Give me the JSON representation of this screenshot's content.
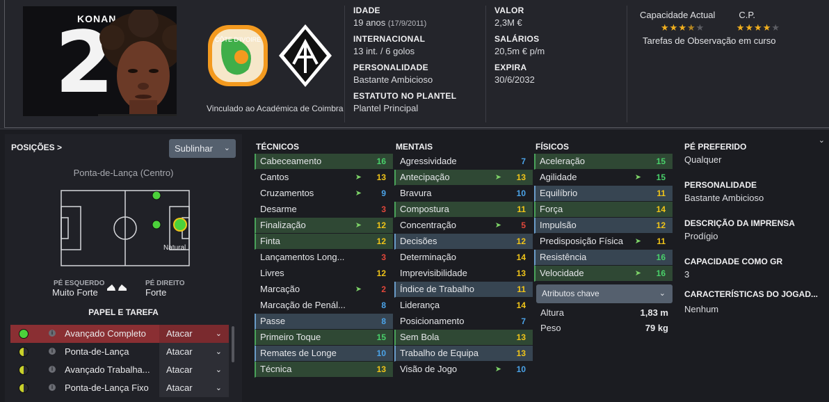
{
  "header": {
    "portrait_name": "KONAN",
    "portrait_number": "2",
    "crest_caption": "Vinculado ao Académica de Coimbra",
    "nation_crest_text": "CÔTE D'IVOIRE",
    "info_col1": [
      {
        "label": "IDADE",
        "value": "19 anos",
        "sub": "(17/9/2011)"
      },
      {
        "label": "INTERNACIONAL",
        "value": "13 int. / 6 golos"
      },
      {
        "label": "PERSONALIDADE",
        "value": "Bastante Ambicioso"
      },
      {
        "label": "ESTATUTO NO PLANTEL",
        "value": "Plantel Principal"
      }
    ],
    "info_col2": [
      {
        "label": "VALOR",
        "value": "2,3M €"
      },
      {
        "label": "SALÁRIOS",
        "value": "20,5m € p/m"
      },
      {
        "label": "EXPIRA",
        "value": "30/6/2032"
      }
    ],
    "ability": {
      "current_label": "Capacidade Actual",
      "potential_label": "C.P.",
      "current_stars": 3.5,
      "potential_stars": 4,
      "max_stars": 5,
      "scouting": "Tarefas de Observação em curso"
    }
  },
  "left": {
    "positions_title": "POSIÇÕES >",
    "highlight_button": "Sublinhar",
    "position_name": "Ponta-de-Lança (Centro)",
    "natural_label": "Natural",
    "left_foot_label": "PÉ ESQUERDO",
    "left_foot_value": "Muito Forte",
    "right_foot_label": "PÉ DIREITO",
    "right_foot_value": "Forte",
    "role_title": "PAPEL E TAREFA",
    "roles": [
      {
        "name": "Avançado Completo",
        "duty": "Atacar",
        "selected": true,
        "dot": "full"
      },
      {
        "name": "Ponta-de-Lança",
        "duty": "Atacar",
        "selected": false,
        "dot": "half"
      },
      {
        "name": "Avançado Trabalha...",
        "duty": "Atacar",
        "selected": false,
        "dot": "half"
      },
      {
        "name": "Ponta-de-Lança Fixo",
        "duty": "Atacar",
        "selected": false,
        "dot": "half"
      }
    ],
    "colors": {
      "role_selected": "#8a2f33",
      "dot_green": "#4cd13b",
      "dot_yellow": "#c9d12b"
    }
  },
  "attributes": {
    "technical": {
      "title": "TÉCNICOS",
      "items": [
        {
          "name": "Cabeceamento",
          "value": "16",
          "hl": "green",
          "arrow": false
        },
        {
          "name": "Cantos",
          "value": "13",
          "hl": "",
          "arrow": true
        },
        {
          "name": "Cruzamentos",
          "value": "9",
          "hl": "",
          "arrow": true
        },
        {
          "name": "Desarme",
          "value": "3",
          "hl": "",
          "arrow": false
        },
        {
          "name": "Finalização",
          "value": "12",
          "hl": "green",
          "arrow": true
        },
        {
          "name": "Finta",
          "value": "12",
          "hl": "green",
          "arrow": false
        },
        {
          "name": "Lançamentos Long...",
          "value": "3",
          "hl": "",
          "arrow": false
        },
        {
          "name": "Livres",
          "value": "12",
          "hl": "",
          "arrow": false
        },
        {
          "name": "Marcação",
          "value": "2",
          "hl": "",
          "arrow": true
        },
        {
          "name": "Marcação de Penál...",
          "value": "8",
          "hl": "",
          "arrow": false
        },
        {
          "name": "Passe",
          "value": "8",
          "hl": "blue",
          "arrow": false
        },
        {
          "name": "Primeiro Toque",
          "value": "15",
          "hl": "green",
          "arrow": false
        },
        {
          "name": "Remates de Longe",
          "value": "10",
          "hl": "blue",
          "arrow": false
        },
        {
          "name": "Técnica",
          "value": "13",
          "hl": "green",
          "arrow": false
        }
      ]
    },
    "mental": {
      "title": "MENTAIS",
      "items": [
        {
          "name": "Agressividade",
          "value": "7",
          "hl": "",
          "arrow": false
        },
        {
          "name": "Antecipação",
          "value": "13",
          "hl": "green",
          "arrow": true
        },
        {
          "name": "Bravura",
          "value": "10",
          "hl": "",
          "arrow": false
        },
        {
          "name": "Compostura",
          "value": "11",
          "hl": "green",
          "arrow": false
        },
        {
          "name": "Concentração",
          "value": "5",
          "hl": "",
          "arrow": true
        },
        {
          "name": "Decisões",
          "value": "12",
          "hl": "blue",
          "arrow": false
        },
        {
          "name": "Determinação",
          "value": "14",
          "hl": "",
          "arrow": false
        },
        {
          "name": "Imprevisibilidade",
          "value": "13",
          "hl": "",
          "arrow": false
        },
        {
          "name": "Índice de Trabalho",
          "value": "11",
          "hl": "blue",
          "arrow": false
        },
        {
          "name": "Liderança",
          "value": "14",
          "hl": "",
          "arrow": false
        },
        {
          "name": "Posicionamento",
          "value": "7",
          "hl": "",
          "arrow": false
        },
        {
          "name": "Sem Bola",
          "value": "13",
          "hl": "green",
          "arrow": false
        },
        {
          "name": "Trabalho de Equipa",
          "value": "13",
          "hl": "blue",
          "arrow": false
        },
        {
          "name": "Visão de Jogo",
          "value": "10",
          "hl": "",
          "arrow": true
        }
      ]
    },
    "physical": {
      "title": "FÍSICOS",
      "items": [
        {
          "name": "Aceleração",
          "value": "15",
          "hl": "green",
          "arrow": false
        },
        {
          "name": "Agilidade",
          "value": "15",
          "hl": "",
          "arrow": true
        },
        {
          "name": "Equilíbrio",
          "value": "11",
          "hl": "blue",
          "arrow": false
        },
        {
          "name": "Força",
          "value": "14",
          "hl": "green",
          "arrow": false
        },
        {
          "name": "Impulsão",
          "value": "12",
          "hl": "blue",
          "arrow": false
        },
        {
          "name": "Predisposição Física",
          "value": "11",
          "hl": "",
          "arrow": true
        },
        {
          "name": "Resistência",
          "value": "16",
          "hl": "blue",
          "arrow": false
        },
        {
          "name": "Velocidade",
          "value": "16",
          "hl": "green",
          "arrow": true
        }
      ]
    },
    "key_attributes_button": "Atributos chave",
    "height_label": "Altura",
    "height_value": "1,83 m",
    "weight_label": "Peso",
    "weight_value": "79 kg"
  },
  "right": {
    "items": [
      {
        "label": "PÉ PREFERIDO",
        "value": "Qualquer"
      },
      {
        "label": "PERSONALIDADE",
        "value": "Bastante Ambicioso"
      },
      {
        "label": "DESCRIÇÃO DA IMPRENSA",
        "value": "Prodígio"
      },
      {
        "label": "CAPACIDADE COMO GR",
        "value": "3"
      },
      {
        "label": "CARACTERÍSTICAS DO JOGAD...",
        "value": "Nenhum"
      }
    ]
  }
}
